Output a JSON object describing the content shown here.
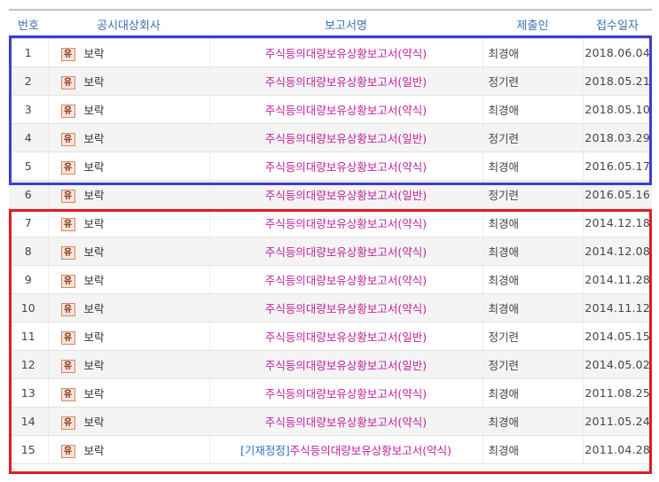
{
  "table": {
    "headers": {
      "num": "번호",
      "company": "공시대상회사",
      "report": "보고서명",
      "filer": "제출인",
      "date": "접수일자"
    },
    "company_badge": "유",
    "rows": [
      {
        "num": "1",
        "company": "보락",
        "prefix": "",
        "report": "주식등의대량보유상황보고서(약식)",
        "filer": "최경애",
        "date": "2018.06.04"
      },
      {
        "num": "2",
        "company": "보락",
        "prefix": "",
        "report": "주식등의대량보유상황보고서(일반)",
        "filer": "정기련",
        "date": "2018.05.21"
      },
      {
        "num": "3",
        "company": "보락",
        "prefix": "",
        "report": "주식등의대량보유상황보고서(약식)",
        "filer": "최경애",
        "date": "2018.05.10"
      },
      {
        "num": "4",
        "company": "보락",
        "prefix": "",
        "report": "주식등의대량보유상황보고서(일반)",
        "filer": "정기련",
        "date": "2018.03.29"
      },
      {
        "num": "5",
        "company": "보락",
        "prefix": "",
        "report": "주식등의대량보유상황보고서(약식)",
        "filer": "최경애",
        "date": "2016.05.17"
      },
      {
        "num": "6",
        "company": "보락",
        "prefix": "",
        "report": "주식등의대량보유상황보고서(일반)",
        "filer": "정기련",
        "date": "2016.05.16"
      },
      {
        "num": "7",
        "company": "보락",
        "prefix": "",
        "report": "주식등의대량보유상황보고서(약식)",
        "filer": "최경애",
        "date": "2014.12.18"
      },
      {
        "num": "8",
        "company": "보락",
        "prefix": "",
        "report": "주식등의대량보유상황보고서(약식)",
        "filer": "최경애",
        "date": "2014.12.08"
      },
      {
        "num": "9",
        "company": "보락",
        "prefix": "",
        "report": "주식등의대량보유상황보고서(약식)",
        "filer": "최경애",
        "date": "2014.11.28"
      },
      {
        "num": "10",
        "company": "보락",
        "prefix": "",
        "report": "주식등의대량보유상황보고서(약식)",
        "filer": "최경애",
        "date": "2014.11.12"
      },
      {
        "num": "11",
        "company": "보락",
        "prefix": "",
        "report": "주식등의대량보유상황보고서(일반)",
        "filer": "정기련",
        "date": "2014.05.15"
      },
      {
        "num": "12",
        "company": "보락",
        "prefix": "",
        "report": "주식등의대량보유상황보고서(일반)",
        "filer": "정기련",
        "date": "2014.05.02"
      },
      {
        "num": "13",
        "company": "보락",
        "prefix": "",
        "report": "주식등의대량보유상황보고서(약식)",
        "filer": "최경애",
        "date": "2011.08.25"
      },
      {
        "num": "14",
        "company": "보락",
        "prefix": "",
        "report": "주식등의대량보유상황보고서(약식)",
        "filer": "최경애",
        "date": "2011.05.24"
      },
      {
        "num": "15",
        "company": "보락",
        "prefix": "[기재정정]",
        "report": "주식등의대량보유상황보고서(약식)",
        "filer": "최경애",
        "date": "2011.04.28"
      }
    ]
  },
  "highlights": {
    "blue_color": "#3b3fd1",
    "red_color": "#e01b24"
  },
  "colors": {
    "header_text": "#3a6fb4",
    "report_link": "#c0229d",
    "prefix_link": "#2a6fc4",
    "badge_bg": "#fbe2d6"
  }
}
